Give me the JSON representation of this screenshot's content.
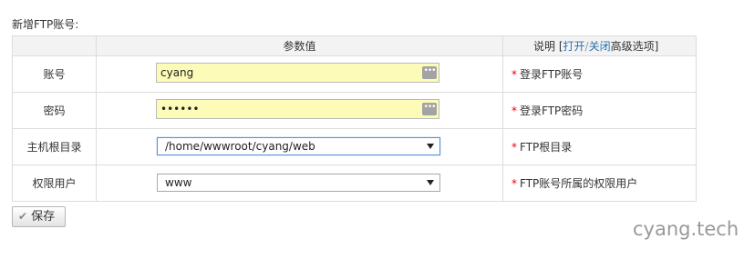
{
  "form": {
    "title": "新增FTP账号:"
  },
  "table": {
    "headers": {
      "name": "",
      "value": "参数值",
      "desc_prefix": "说明 [",
      "toggle_open": "打开",
      "separator": "/",
      "toggle_close": "关闭",
      "advanced": "高级选项",
      "desc_suffix": "]"
    },
    "rows": [
      {
        "label": "账号",
        "value": "cyang",
        "required_mark": "*",
        "desc": "登录FTP账号"
      },
      {
        "label": "密码",
        "value": "••••••",
        "required_mark": "*",
        "desc": "登录FTP密码"
      },
      {
        "label": "主机根目录",
        "value": "/home/wwwroot/cyang/web",
        "required_mark": "*",
        "desc": "FTP根目录"
      },
      {
        "label": "权限用户",
        "value": "www",
        "required_mark": "*",
        "desc": "FTP账号所属的权限用户"
      }
    ]
  },
  "actions": {
    "save_label": "保存",
    "check_glyph": "✔"
  },
  "icons": {
    "password_manager_glyph": "•••"
  },
  "watermark": "cyang.tech",
  "colors": {
    "input_bg": "#fcfcb8",
    "required": "#e00000",
    "header_bg": "#f3f3f3",
    "focus_border": "#5b8fd8"
  }
}
